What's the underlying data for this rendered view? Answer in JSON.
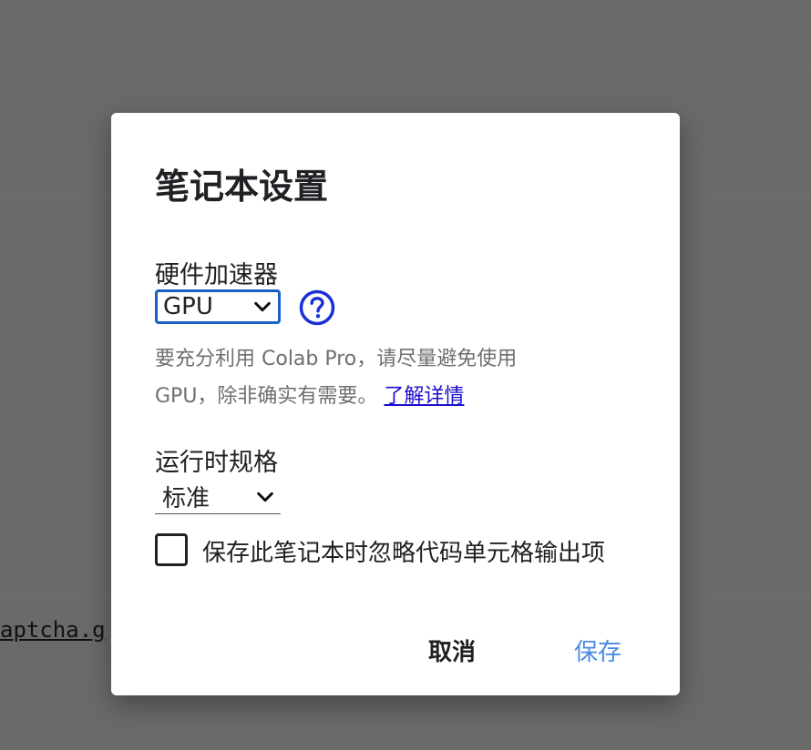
{
  "background": {
    "code_fragment": "aptcha.g"
  },
  "dialog": {
    "title": "笔记本设置",
    "hardware_accelerator": {
      "label": "硬件加速器",
      "selected": "GPU",
      "help_icon": "question-circle-icon"
    },
    "description": {
      "text": "要充分利用 Colab Pro，请尽量避免使用 GPU，除非确实有需要。",
      "link": "了解详情"
    },
    "runtime_shape": {
      "label": "运行时规格",
      "selected": "标准"
    },
    "omit_output_checkbox": {
      "label": "保存此笔记本时忽略代码单元格输出项",
      "checked": false
    },
    "buttons": {
      "cancel": "取消",
      "save": "保存"
    }
  },
  "colors": {
    "overlay": "#6a6a6a",
    "accent": "#1a5fc8",
    "link": "#1a0dcc",
    "save_button": "#4a8be0",
    "help_icon": "#1a2fd6"
  }
}
